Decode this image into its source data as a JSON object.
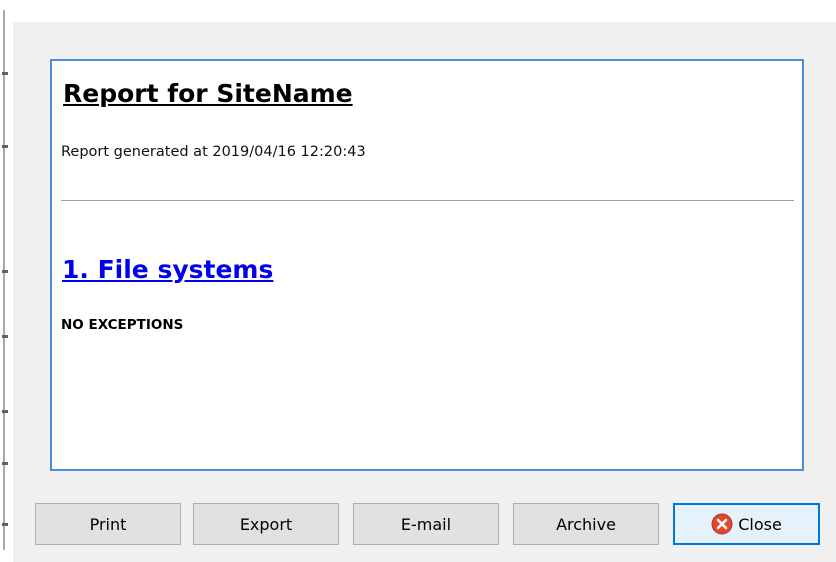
{
  "report": {
    "title": "Report for SiteName",
    "generated_text": "Report generated at 2019/04/16 12:20:43",
    "sections": [
      {
        "label": "1. File systems",
        "status": "NO EXCEPTIONS"
      }
    ]
  },
  "buttons": {
    "print": "Print",
    "export": "Export",
    "email": "E-mail",
    "archive": "Archive",
    "close": "Close"
  },
  "colors": {
    "panel_border": "#4a90d9",
    "link": "#0000ee",
    "close_icon": "#e0472f",
    "focus_border": "#0078d7"
  },
  "icons": {
    "close": "close-circle-icon"
  }
}
